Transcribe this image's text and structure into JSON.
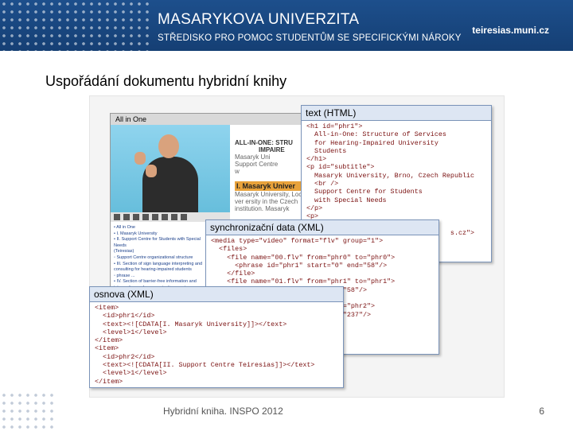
{
  "header": {
    "university": "MASARYKOVA UNIVERZITA",
    "subtitle": "STŘEDISKO PRO POMOC STUDENTŮM SE SPECIFICKÝMI NÁROKY",
    "site": "teiresias.muni.cz"
  },
  "slide": {
    "title": "Uspořádání dokumentu hybridní knihy",
    "footer": "Hybridní kniha. INSPO 2012",
    "page_number": "6"
  },
  "player": {
    "window_title": "All in One",
    "doc_title_line1": "ALL-IN-ONE: STRU",
    "doc_title_line2": "IMPAIRE",
    "doc_lines": [
      "Masaryk Uni",
      "Support Centre",
      "w"
    ],
    "doc_section": "I. Masaryk Univer",
    "doc_body": [
      "Masaryk University, Loc",
      "ver ersity in the Czech",
      "institution. Masaryk"
    ],
    "toc": [
      "• All in One",
      "• I. Masaryk University",
      "• II. Support Centre for Students with Special Needs",
      "  (Teiresias)",
      "  ◦ Support Centre organizational structure",
      "• III. Section of sign language interpreting and",
      "  consulting for hearing-impaired students",
      "  ◦ phrase ...",
      "• IV. Section of barrier-free information and",
      "  interpreting and communication services",
      "• V. Contact information"
    ]
  },
  "panels": {
    "html": {
      "title": "text (HTML)",
      "lines": [
        "<h1 id=\"phr1\">",
        "  All-in-One: Structure of Services",
        "  for Hearing-Impaired University",
        "  Students",
        "</h1>",
        "<p id=\"subtitle\">",
        "  Masaryk University, Brno, Czech Republic",
        "  <br />",
        "  Support Centre for Students",
        "  with Special Needs",
        "</p>",
        "<p>",
        "",
        "                                    s.cz\">"
      ]
    },
    "sync": {
      "title": "synchronizační data (XML)",
      "lines": [
        "<media type=\"video\" format=\"flv\" group=\"1\">",
        "  <files>",
        "    <file name=\"00.flv\" from=\"phr0\" to=\"phr0\">",
        "      <phrase id=\"phr1\" start=\"0\" end=\"58\"/>",
        "    </file>",
        "    <file name=\"01.flv\" from=\"phr1\" to=\"phr1\">",
        "                        =\"0\" end=\"58\"/>",
        "",
        "                        \"phr2\" to=\"phr2\">",
        "                        =\"0\" end=\"237\"/>"
      ]
    },
    "outline": {
      "title": "osnova (XML)",
      "lines": [
        "<item>",
        "  <id>phr1</id>",
        "  <text><![CDATA[I. Masaryk University]]></text>",
        "  <level>1</level>",
        "</item>",
        "<item>",
        "  <id>phr2</id>",
        "  <text><![CDATA[II. Support Centre Teiresias]]></text>",
        "  <level>1</level>",
        "</item>"
      ]
    }
  }
}
